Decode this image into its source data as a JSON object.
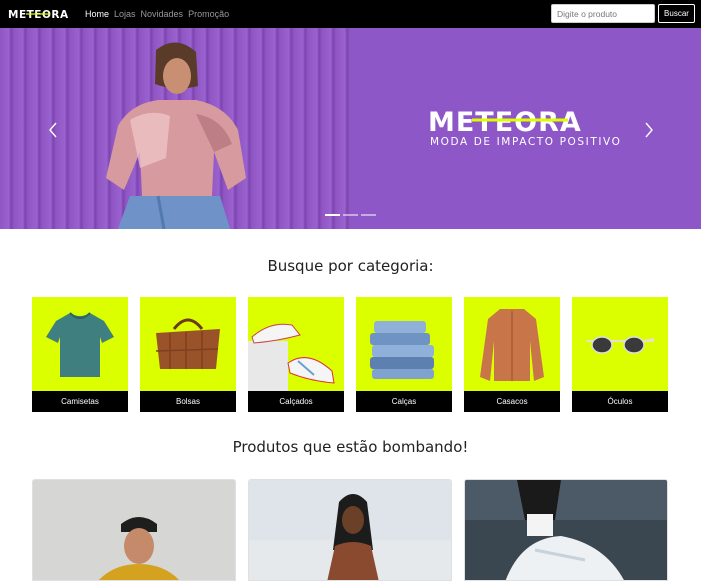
{
  "colors": {
    "navbar": "#000000",
    "hero_bg": "#8e57c8",
    "accent_lime": "#dcff00",
    "text_dark": "#222222"
  },
  "navbar": {
    "brand": "METEORA",
    "links": [
      {
        "label": "Home",
        "active": true
      },
      {
        "label": "Lojas",
        "active": false
      },
      {
        "label": "Novidades",
        "active": false
      },
      {
        "label": "Promoção",
        "active": false
      }
    ],
    "search": {
      "placeholder": "Digite o produto",
      "value": "",
      "button_label": "Buscar"
    }
  },
  "hero": {
    "logo_text": "METEORA",
    "tagline": "MODA DE IMPACTO POSITIVO",
    "slide_count": 3,
    "active_slide": 1,
    "icons": [
      "chevron-left-icon",
      "chevron-right-icon"
    ]
  },
  "categories": {
    "title": "Busque por categoria:",
    "items": [
      {
        "label": "Camisetas",
        "icon": "tshirt"
      },
      {
        "label": "Bolsas",
        "icon": "bag"
      },
      {
        "label": "Calçados",
        "icon": "sneakers"
      },
      {
        "label": "Calças",
        "icon": "jeans"
      },
      {
        "label": "Casacos",
        "icon": "jacket"
      },
      {
        "label": "Óculos",
        "icon": "sunglasses"
      }
    ]
  },
  "products": {
    "title": "Produtos que estão bombando!"
  }
}
